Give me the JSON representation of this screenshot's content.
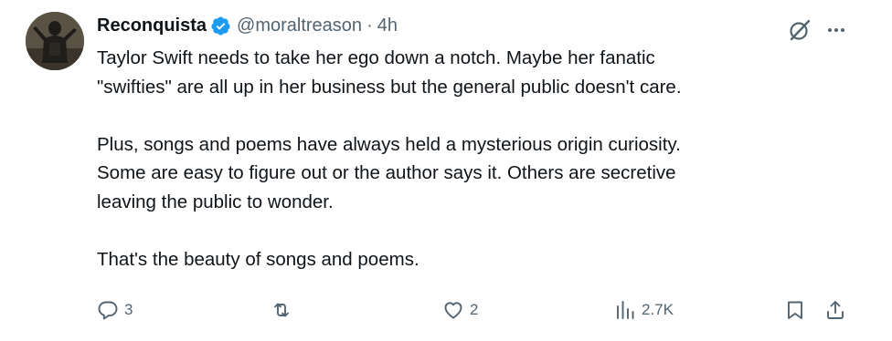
{
  "tweet": {
    "author": {
      "display_name": "Reconquista",
      "handle": "@moraltreason",
      "verified": true,
      "verified_color": "#1d9bf0"
    },
    "separator": "·",
    "timestamp": "4h",
    "paragraphs": [
      [
        "Taylor Swift needs to take her ego down a notch. Maybe her fanatic",
        "\"swifties\" are all up in her business but the general public doesn't care."
      ],
      [
        "Plus, songs and poems have always held a mysterious origin curiosity.",
        "Some are easy to figure out or the author says it. Others are secretive",
        "leaving the public to wonder."
      ],
      [
        "That's the beauty of songs and poems."
      ]
    ],
    "actions": {
      "reply_count": "3",
      "repost_count": "",
      "like_count": "2",
      "views_count": "2.7K"
    },
    "icons": {
      "grok": "grok-icon",
      "more": "more-icon",
      "reply": "reply-icon",
      "repost": "repost-icon",
      "like": "like-icon",
      "views": "views-icon",
      "bookmark": "bookmark-icon",
      "share": "share-icon"
    },
    "colors": {
      "text": "#0f1419",
      "secondary": "#536471"
    }
  }
}
